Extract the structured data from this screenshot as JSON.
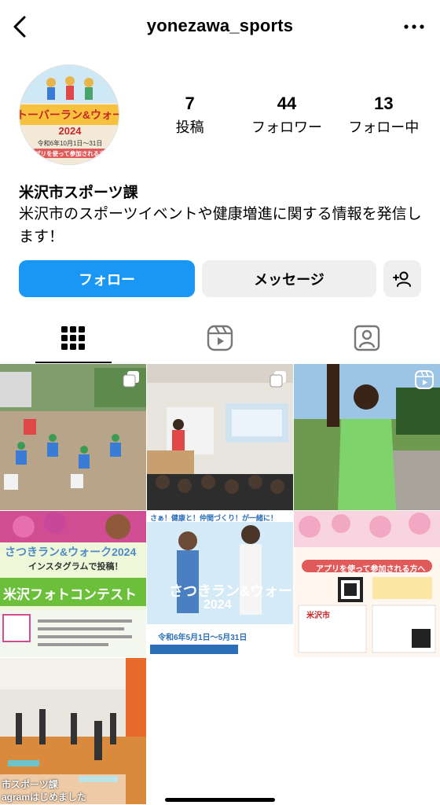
{
  "header": {
    "username": "yonezawa_sports"
  },
  "avatar": {
    "banner": "クトーバーラン&ウォーク",
    "year": "2024",
    "dates": "令和6年10月1日～31日",
    "tagline": "アプリを使って参加される方へ"
  },
  "stats": [
    {
      "value": "7",
      "label": "投稿"
    },
    {
      "value": "44",
      "label": "フォロワー"
    },
    {
      "value": "13",
      "label": "フォロー中"
    }
  ],
  "profile": {
    "name": "米沢市スポーツ課",
    "bio": "米沢市のスポーツイベントや健康増進に関する情報を発信します！"
  },
  "actions": {
    "follow": "フォロー",
    "message": "メッセージ"
  },
  "posts": {
    "p4_title": "さつきラン&ウォーク2024",
    "p4_sub": "インスタグラムで投稿！",
    "p4_contest": "米沢フォトコンテスト",
    "p5_top": "さぁ！健康と！仲間づくり！が一緒に！",
    "p5_title": "さつきラン&ウォーク",
    "p5_year": "2024",
    "p5_dates": "令和6年5月1日～5月31日",
    "p6_title": "アプリを使って参加される方へ",
    "p6_city": "米沢市",
    "p7_caption_1": "市スポーツ課",
    "p7_caption_2": "agramはじめました"
  }
}
